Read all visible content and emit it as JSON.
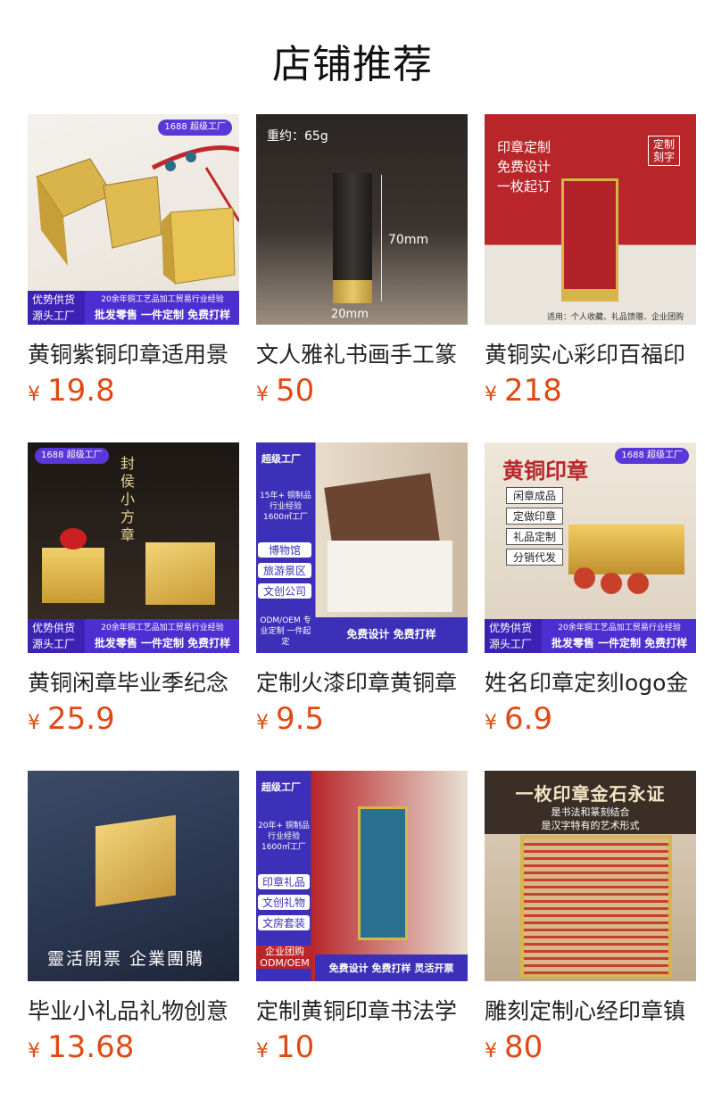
{
  "page_title": "店铺推荐",
  "currency_symbol": "¥",
  "products": [
    {
      "name": "黄铜紫铜印章适用景",
      "price": "19.8",
      "image": {
        "brand_badge": "1688 超级工厂",
        "banner_left": "优势供货 源头工厂",
        "banner_top": "20余年铜工艺品加工贸易行业经验",
        "banner_bottom": "批发零售 一件定制 免费打样"
      }
    },
    {
      "name": "文人雅礼书画手工篆",
      "price": "50",
      "image": {
        "weight": "重约：65g",
        "height_label": "70mm",
        "width_label": "20mm"
      }
    },
    {
      "name": "黄铜实心彩印百福印",
      "price": "218",
      "image": {
        "lines": [
          "印章定制",
          "免费设计",
          "一枚起订"
        ],
        "tag": "定制刻字",
        "footer": "适用：个人收藏、礼品馈赠、企业团购"
      }
    },
    {
      "name": "黄铜闲章毕业季纪念",
      "price": "25.9",
      "image": {
        "brand_badge": "1688 超级工厂",
        "vertical_title": "封侯小方章",
        "banner_left": "优势供货 源头工厂",
        "banner_top": "20余年铜工艺品加工贸易行业经验",
        "banner_bottom": "批发零售 一件定制 免费打样"
      }
    },
    {
      "name": "定制火漆印章黄铜章",
      "price": "9.5",
      "image": {
        "brand_badge": "超级工厂",
        "experience": "15年+ 铜制品行业经验 1600㎡工厂",
        "tags": [
          "博物馆",
          "旅游景区",
          "文创公司"
        ],
        "oem": "ODM/OEM 专业定制 一件起定",
        "banner": "免费设计 免费打样"
      }
    },
    {
      "name": "姓名印章定刻logo金",
      "price": "6.9",
      "image": {
        "brand_badge": "1688 超级工厂",
        "headline": "黄铜印章",
        "tags": [
          "闲章成品",
          "定做印章",
          "礼品定制",
          "分销代发"
        ],
        "banner_left": "优势供货 源头工厂",
        "banner_top": "20余年铜工艺品加工贸易行业经验",
        "banner_bottom": "批发零售 一件定制 免费打样"
      }
    },
    {
      "name": "毕业小礼品礼物创意",
      "price": "13.68",
      "image": {
        "caption": "靈活開票 企業團購"
      }
    },
    {
      "name": "定制黄铜印章书法学",
      "price": "10",
      "image": {
        "brand_badge": "超级工厂",
        "experience": "20年+ 铜制品行业经验 1600㎡工厂",
        "tags": [
          "印章礼品",
          "文创礼物",
          "文房套装"
        ],
        "oem": "企业团购 ODM/OEM",
        "banner": "免费设计 免费打样 灵活开票"
      }
    },
    {
      "name": "雕刻定制心经印章镇",
      "price": "80",
      "image": {
        "headline": "一枚印章金石永证",
        "sub1": "是书法和篆刻结合",
        "sub2": "是汉字特有的艺术形式"
      }
    }
  ],
  "colors": {
    "price": "#e04a12",
    "banner_purple": "#4b2fd0",
    "seal_red": "#b8262a",
    "brass": "#d9b44a"
  }
}
